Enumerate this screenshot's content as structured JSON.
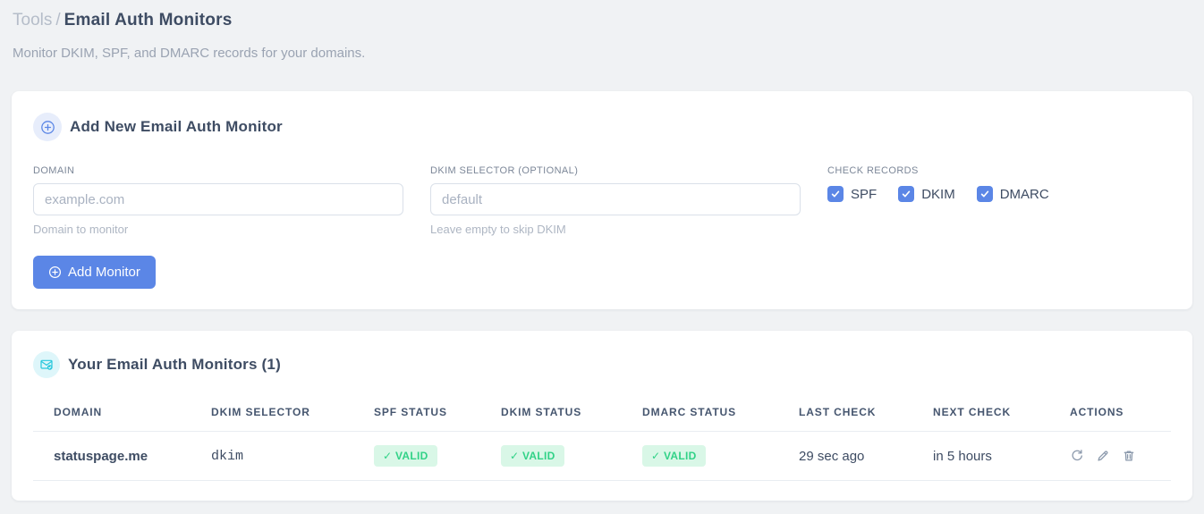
{
  "page": {
    "breadcrumb": {
      "section": "Tools",
      "separator": "/",
      "current": "Email Auth Monitors"
    },
    "subtitle": "Monitor DKIM, SPF, and DMARC records for your domains."
  },
  "add_monitor_card": {
    "icon": "plus-circle-icon",
    "title": "Add New Email Auth Monitor",
    "fields": {
      "domain": {
        "label": "DOMAIN",
        "value": "",
        "placeholder": "example.com",
        "helper": "Domain to monitor"
      },
      "dkim_selector": {
        "label": "DKIM SELECTOR (OPTIONAL)",
        "value": "",
        "placeholder": "default",
        "helper": "Leave empty to skip DKIM"
      }
    },
    "check_records": {
      "label": "CHECK RECORDS",
      "options": [
        {
          "label": "SPF",
          "checked": true
        },
        {
          "label": "DKIM",
          "checked": true
        },
        {
          "label": "DMARC",
          "checked": true
        }
      ]
    },
    "submit_label": "Add Monitor"
  },
  "monitors_card": {
    "icon": "email-check-icon",
    "title": "Your Email Auth Monitors (1)",
    "count": 1,
    "table": {
      "headers": [
        "DOMAIN",
        "DKIM SELECTOR",
        "SPF STATUS",
        "DKIM STATUS",
        "DMARC STATUS",
        "LAST CHECK",
        "NEXT CHECK",
        "ACTIONS"
      ],
      "rows": [
        {
          "domain": "statuspage.me",
          "dkim_selector": "dkim",
          "spf_status": "✓ VALID",
          "dkim_status": "✓ VALID",
          "dmarc_status": "✓ VALID",
          "last_check": "29 sec ago",
          "next_check": "in 5 hours",
          "actions": [
            "refresh-icon",
            "edit-icon",
            "delete-icon"
          ]
        }
      ]
    }
  },
  "colors": {
    "accent_blue": "#5b86e6",
    "icon_circle_blue_bg": "#e7edfb",
    "icon_cyan": "#29c8dc",
    "icon_circle_cyan_bg": "#def6fa",
    "badge_green_bg": "#d9f7e7",
    "badge_green_text": "#31d287",
    "code_pink": "#e84c85",
    "page_bg": "#f0f2f4"
  }
}
